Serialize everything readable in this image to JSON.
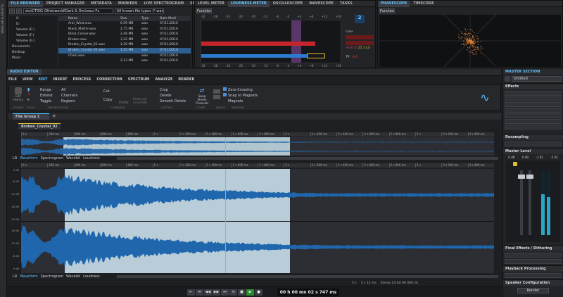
{
  "left_strip": {
    "label": "WAVELAB ELEMENTS"
  },
  "top_left_tabs": [
    "FILE BROWSER",
    "PROJECT MANAGER",
    "METADATA",
    "MARKERS",
    "LIVE SPECTROGRAM",
    "SP"
  ],
  "top_mid_tabs": [
    "LEVEL METER",
    "LOUDNESS METER",
    "OSCILLOSCOPE",
    "WAVESCOPE",
    "TASKS"
  ],
  "top_right_tabs": [
    "PHASESCOPE",
    "TIMECODE"
  ],
  "browser": {
    "path": "ets\\CT001 Otherworld\\Dark & Ominous Fx",
    "filter": "All known file types (*.wav",
    "cols": [
      "Name",
      "Size",
      "Type",
      "Date Modi"
    ],
    "tree": [
      "C:",
      "D:",
      "Volume (E:)",
      "Volume (F:)",
      "Volume (G:)",
      "Documents",
      "Desktop",
      "Music"
    ],
    "files": [
      [
        "Anti_Wind.wav",
        "6,59 MB",
        "wav",
        "07/11/2016"
      ],
      [
        "Black_Matter.wav",
        "2,75 MB",
        "wav",
        "07/11/2016"
      ],
      [
        "Blind_Corner.wav",
        "2,48 MB",
        "wav",
        "07/11/2016"
      ],
      [
        "Broken.wav",
        "3,32 MB",
        "wav",
        "07/11/2016"
      ],
      [
        "Broken_Crystal_01.wav",
        "1,30 MB",
        "wav",
        "07/11/2016"
      ],
      [
        "Broken_Crystal_02.wav",
        "1,55 MB",
        "wav",
        "07/11/2016"
      ],
      [
        "Chain.wav",
        "",
        "wav",
        "07/11/2016"
      ],
      [
        "",
        "2,13 MB",
        "wav",
        "07/11/2016"
      ]
    ]
  },
  "loudness": {
    "functions": "Functions",
    "scale": [
      "-32",
      "-28",
      "-24",
      "-20",
      "-16",
      "-12",
      "-8",
      "-4",
      "+4",
      "+8",
      "+12",
      "+16"
    ],
    "gate": "Gate",
    "lu_val": "-9.0 LU",
    "lu_box": "25.3 LU",
    "tp": "TP",
    "tp_val": "-4.0"
  },
  "phase": {
    "functions": "Functions"
  },
  "editor_tabs": [
    "AUDIO EDITOR"
  ],
  "ribbon_tabs": [
    "FILE",
    "VIEW",
    "EDIT",
    "INSERT",
    "PROCESS",
    "CORRECTION",
    "SPECTRUM",
    "ANALYZE",
    "RENDER"
  ],
  "ribbon": {
    "edit_history": "Edit History",
    "range": "Range",
    "all": "All",
    "extend": "Extend",
    "channels": "Channels",
    "toggle": "Toggle",
    "regions": "Regions",
    "cut": "Cut",
    "copy": "Copy",
    "paste": "Paste",
    "paste_crossfade": "Paste and Crossfade",
    "crop": "Crop",
    "delete": "Delete",
    "smooth_delete": "Smooth Delete",
    "swap": "Swap Stereo Channels",
    "zero": "Zero-Crossing",
    "snap": "Snap to Magnets",
    "magnets": "Magnets",
    "groups": [
      "SOURCE",
      "TOOLS",
      "TIME SELECTION",
      "CLIPBOARD",
      "CUTTING",
      "OTHER",
      "NUDGE",
      "SNAPPING"
    ]
  },
  "file_group": "File Group 1",
  "file_tab": "Broken_Crystal_02",
  "overview_ruler": [
    "0 s",
    "200 ms",
    "400 ms",
    "600 ms",
    "800 ms",
    "1 s",
    "1 s 200 ms",
    "1 s 400 ms",
    "1 s 600 ms",
    "1 s 800 ms",
    "2 s",
    "2 s 200 ms",
    "2 s 400 ms",
    "2 s 600 ms",
    "2 s 800 ms",
    "3 s",
    "3 s 200 ms",
    "3 s 400 ms"
  ],
  "main_ruler": [
    "0 s",
    "200 ms",
    "400 ms",
    "600 ms",
    "800 ms",
    "1 s",
    "1 s 200 ms",
    "1 s 400 ms",
    "1 s 600 ms",
    "1 s 800 ms",
    "2 s",
    "2 s 200 ms",
    "2 s 400 ms",
    "2 s 600 ms",
    "2 s 800 ms",
    "3 s",
    "3 s 200 ms",
    "3 s 400 ms"
  ],
  "wave_tabs": [
    "LR",
    "Waveform",
    "Spectrogram",
    "Wavelet",
    "Loudness"
  ],
  "db_labels": [
    "0 dB",
    "-6 dB",
    "-12 dB",
    "-18 dB",
    "-24 dB",
    "-18 dB",
    "-12 dB",
    "-6 dB",
    "0 dB"
  ],
  "status": {
    "zoom": "5 s",
    "time": "3 s 12 ms",
    "info": "Stereo 24 bit 96 000 Hz"
  },
  "transport": {
    "time": "00 h 00 mn 02 s 747 ms"
  },
  "master": {
    "title": "MASTER SECTION",
    "preset": "Untitled",
    "effects": "Effects",
    "resampling": "Resampling",
    "master_level": "Master Level",
    "levels": [
      "0 dB",
      "0 dB",
      "-1.62",
      "-2.02"
    ],
    "final": "Final Effects / Dithering",
    "playback": "Playback Processing",
    "speaker": "Speaker Configuration",
    "render": "Render"
  }
}
